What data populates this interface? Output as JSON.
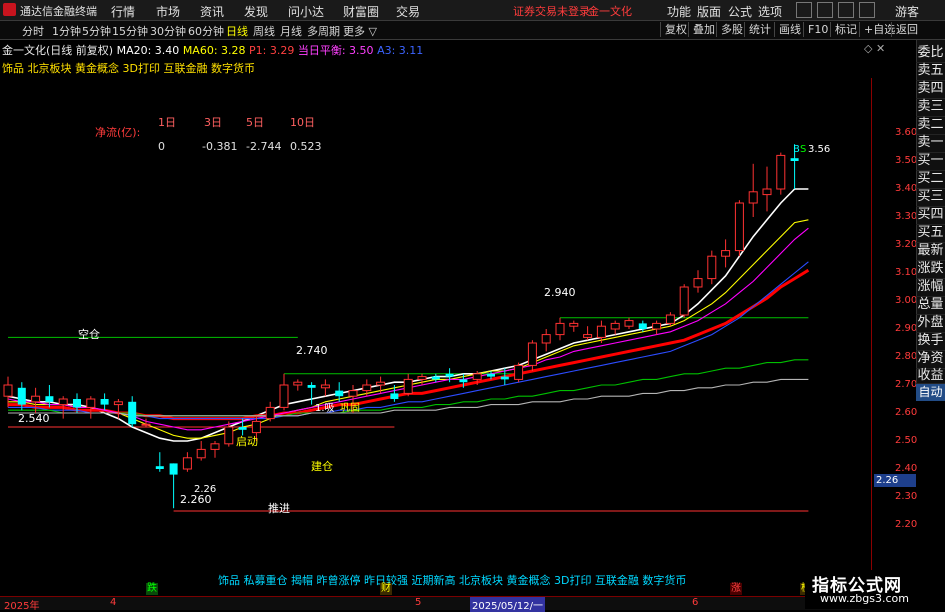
{
  "titlebar": {
    "app_title": "通达信金融终端",
    "menus": [
      "行情",
      "市场",
      "资讯",
      "发现",
      "问小达",
      "财富圈",
      "交易"
    ],
    "login_status": "证券交易未登录",
    "stock_name": "金一文化",
    "right_menus": [
      "功能",
      "版面",
      "公式",
      "选项"
    ],
    "guest": "游客"
  },
  "period_tabs": [
    "分时",
    "1分钟",
    "5分钟",
    "15分钟",
    "30分钟",
    "60分钟",
    "日线",
    "周线",
    "月线",
    "多周期",
    "更多 ▽"
  ],
  "active_period": "日线",
  "toolbar_buttons": [
    "复权",
    "叠加",
    "多股",
    "统计",
    "画线",
    "F10",
    "标记",
    "+自选",
    "返回"
  ],
  "info_line": {
    "stock": "金一文化(日线 前复权)",
    "ma20": "MA20: 3.40",
    "ma60": "MA60: 3.28",
    "p1": "P1: 3.29",
    "balance": "当日平衡: 3.50",
    "a3": "A3: 3.11"
  },
  "concept_line": "饰品 北京板块 黄金概念 3D打印 互联金融 数字货币",
  "net_flow": {
    "label": "净流(亿):",
    "headers": [
      "1日",
      "3日",
      "5日",
      "10日"
    ],
    "values": [
      "0",
      "-0.381",
      "-2.744",
      "0.523"
    ]
  },
  "sidebar_tabs": [
    "委比",
    "卖五",
    "卖四",
    "卖三",
    "卖二",
    "卖一",
    "买一",
    "买二",
    "买三",
    "买四",
    "买五",
    "最新",
    "涨跌",
    "涨幅",
    "总量",
    "外盘",
    "换手",
    "净资",
    "收益"
  ],
  "sidebar_auto": "自动",
  "price_ticks": [
    "3.60",
    "3.50",
    "3.40",
    "3.30",
    "3.20",
    "3.10",
    "3.00",
    "2.90",
    "2.80",
    "2.70",
    "2.60",
    "2.50",
    "2.40",
    "2.30",
    "2.20"
  ],
  "current_price_tag": "2.26",
  "annotations": {
    "kong_cang": "空仓",
    "qi_dong": "启动",
    "jian_cang": "建仓",
    "tui_jin": "推进",
    "low_a": "2.260",
    "low_b": "2.26",
    "left_low": "2.540",
    "high_a": "2.740",
    "high_b": "2.940",
    "recent_high": "3.56",
    "buy_mark": "B",
    "sell_mark": "S",
    "mid_label": "巩固",
    "mid_label2": "1.吸"
  },
  "bottom_concepts": "饰品 私募重仓 揭帽 昨曾涨停 昨日较强 近期新高 北京板块 黄金概念 3D打印 互联金融 数字货币",
  "event_marks": {
    "die": "跌",
    "cai": "财",
    "zhang": "涨",
    "bang": "榜"
  },
  "date_labels": [
    "2025年",
    "4",
    "5",
    "6"
  ],
  "date_cursor": "2025/05/12/一",
  "watermark": {
    "cn": "指标公式网",
    "url": "www.zbgs3.com"
  },
  "colors": {
    "up": "#ff3232",
    "down": "#00ffff",
    "accent": "#ffff00",
    "axis": "#ff3b3b"
  },
  "chart_data": {
    "type": "candlestick",
    "ylim": [
      2.14,
      3.68
    ],
    "candles": [
      {
        "o": 2.66,
        "h": 2.73,
        "l": 2.62,
        "c": 2.7
      },
      {
        "o": 2.69,
        "h": 2.71,
        "l": 2.61,
        "c": 2.63
      },
      {
        "o": 2.64,
        "h": 2.69,
        "l": 2.6,
        "c": 2.66
      },
      {
        "o": 2.66,
        "h": 2.7,
        "l": 2.62,
        "c": 2.64
      },
      {
        "o": 2.63,
        "h": 2.66,
        "l": 2.58,
        "c": 2.65
      },
      {
        "o": 2.65,
        "h": 2.67,
        "l": 2.6,
        "c": 2.62
      },
      {
        "o": 2.62,
        "h": 2.66,
        "l": 2.58,
        "c": 2.65
      },
      {
        "o": 2.65,
        "h": 2.67,
        "l": 2.61,
        "c": 2.63
      },
      {
        "o": 2.63,
        "h": 2.65,
        "l": 2.58,
        "c": 2.64
      },
      {
        "o": 2.64,
        "h": 2.66,
        "l": 2.55,
        "c": 2.56
      },
      {
        "o": 2.56,
        "h": 2.58,
        "l": 2.55,
        "c": 2.56
      },
      {
        "o": 2.41,
        "h": 2.46,
        "l": 2.39,
        "c": 2.4
      },
      {
        "o": 2.42,
        "h": 2.42,
        "l": 2.26,
        "c": 2.38
      },
      {
        "o": 2.4,
        "h": 2.46,
        "l": 2.39,
        "c": 2.44
      },
      {
        "o": 2.44,
        "h": 2.5,
        "l": 2.43,
        "c": 2.47
      },
      {
        "o": 2.47,
        "h": 2.5,
        "l": 2.44,
        "c": 2.49
      },
      {
        "o": 2.49,
        "h": 2.57,
        "l": 2.48,
        "c": 2.55
      },
      {
        "o": 2.55,
        "h": 2.58,
        "l": 2.52,
        "c": 2.54
      },
      {
        "o": 2.53,
        "h": 2.59,
        "l": 2.5,
        "c": 2.57
      },
      {
        "o": 2.58,
        "h": 2.64,
        "l": 2.57,
        "c": 2.62
      },
      {
        "o": 2.62,
        "h": 2.74,
        "l": 2.61,
        "c": 2.7
      },
      {
        "o": 2.7,
        "h": 2.72,
        "l": 2.68,
        "c": 2.71
      },
      {
        "o": 2.7,
        "h": 2.71,
        "l": 2.63,
        "c": 2.69
      },
      {
        "o": 2.69,
        "h": 2.72,
        "l": 2.66,
        "c": 2.7
      },
      {
        "o": 2.68,
        "h": 2.71,
        "l": 2.64,
        "c": 2.66
      },
      {
        "o": 2.66,
        "h": 2.7,
        "l": 2.6,
        "c": 2.68
      },
      {
        "o": 2.68,
        "h": 2.72,
        "l": 2.66,
        "c": 2.7
      },
      {
        "o": 2.7,
        "h": 2.73,
        "l": 2.67,
        "c": 2.71
      },
      {
        "o": 2.67,
        "h": 2.7,
        "l": 2.64,
        "c": 2.65
      },
      {
        "o": 2.67,
        "h": 2.74,
        "l": 2.66,
        "c": 2.72
      },
      {
        "o": 2.72,
        "h": 2.74,
        "l": 2.7,
        "c": 2.73
      },
      {
        "o": 2.73,
        "h": 2.74,
        "l": 2.71,
        "c": 2.72
      },
      {
        "o": 2.74,
        "h": 2.76,
        "l": 2.71,
        "c": 2.73
      },
      {
        "o": 2.72,
        "h": 2.74,
        "l": 2.69,
        "c": 2.71
      },
      {
        "o": 2.72,
        "h": 2.75,
        "l": 2.7,
        "c": 2.74
      },
      {
        "o": 2.74,
        "h": 2.75,
        "l": 2.72,
        "c": 2.73
      },
      {
        "o": 2.73,
        "h": 2.76,
        "l": 2.7,
        "c": 2.72
      },
      {
        "o": 2.72,
        "h": 2.78,
        "l": 2.71,
        "c": 2.77
      },
      {
        "o": 2.77,
        "h": 2.86,
        "l": 2.75,
        "c": 2.85
      },
      {
        "o": 2.85,
        "h": 2.9,
        "l": 2.82,
        "c": 2.88
      },
      {
        "o": 2.88,
        "h": 2.94,
        "l": 2.86,
        "c": 2.92
      },
      {
        "o": 2.91,
        "h": 2.93,
        "l": 2.89,
        "c": 2.92
      },
      {
        "o": 2.87,
        "h": 2.91,
        "l": 2.86,
        "c": 2.88
      },
      {
        "o": 2.87,
        "h": 2.93,
        "l": 2.85,
        "c": 2.91
      },
      {
        "o": 2.9,
        "h": 2.93,
        "l": 2.88,
        "c": 2.92
      },
      {
        "o": 2.91,
        "h": 2.94,
        "l": 2.9,
        "c": 2.93
      },
      {
        "o": 2.92,
        "h": 2.93,
        "l": 2.89,
        "c": 2.9
      },
      {
        "o": 2.9,
        "h": 2.93,
        "l": 2.88,
        "c": 2.92
      },
      {
        "o": 2.92,
        "h": 2.96,
        "l": 2.91,
        "c": 2.95
      },
      {
        "o": 2.95,
        "h": 3.06,
        "l": 2.94,
        "c": 3.05
      },
      {
        "o": 3.05,
        "h": 3.11,
        "l": 3.03,
        "c": 3.08
      },
      {
        "o": 3.08,
        "h": 3.18,
        "l": 3.06,
        "c": 3.16
      },
      {
        "o": 3.16,
        "h": 3.22,
        "l": 3.12,
        "c": 3.18
      },
      {
        "o": 3.18,
        "h": 3.36,
        "l": 3.16,
        "c": 3.35
      },
      {
        "o": 3.35,
        "h": 3.49,
        "l": 3.3,
        "c": 3.39
      },
      {
        "o": 3.38,
        "h": 3.48,
        "l": 3.32,
        "c": 3.4
      },
      {
        "o": 3.4,
        "h": 3.53,
        "l": 3.38,
        "c": 3.52
      },
      {
        "o": 3.51,
        "h": 3.56,
        "l": 3.4,
        "c": 3.5
      }
    ],
    "ma_lines": [
      {
        "color": "#ffffff",
        "values": [
          2.66,
          2.65,
          2.64,
          2.64,
          2.63,
          2.63,
          2.62,
          2.6,
          2.58,
          2.55,
          2.53,
          2.51,
          2.5,
          2.5,
          2.51,
          2.53,
          2.55,
          2.57,
          2.59,
          2.61,
          2.63,
          2.64,
          2.65,
          2.66,
          2.67,
          2.68,
          2.69,
          2.7,
          2.71,
          2.71,
          2.72,
          2.73,
          2.73,
          2.74,
          2.74,
          2.75,
          2.76,
          2.77,
          2.79,
          2.81,
          2.83,
          2.85,
          2.86,
          2.87,
          2.88,
          2.89,
          2.9,
          2.91,
          2.92,
          2.95,
          2.99,
          3.04,
          3.09,
          3.16,
          3.23,
          3.29,
          3.35,
          3.4,
          3.4
        ]
      },
      {
        "color": "#ffff00",
        "values": [
          2.64,
          2.64,
          2.63,
          2.63,
          2.63,
          2.62,
          2.62,
          2.61,
          2.6,
          2.58,
          2.56,
          2.54,
          2.52,
          2.51,
          2.51,
          2.52,
          2.53,
          2.55,
          2.56,
          2.58,
          2.6,
          2.61,
          2.62,
          2.64,
          2.65,
          2.66,
          2.67,
          2.68,
          2.69,
          2.7,
          2.71,
          2.72,
          2.72,
          2.73,
          2.74,
          2.75,
          2.75,
          2.76,
          2.78,
          2.8,
          2.82,
          2.84,
          2.85,
          2.86,
          2.87,
          2.88,
          2.89,
          2.9,
          2.91,
          2.93,
          2.96,
          2.99,
          3.03,
          3.08,
          3.13,
          3.18,
          3.23,
          3.28,
          3.29
        ]
      },
      {
        "color": "#ff0000",
        "values": [
          2.63,
          2.63,
          2.62,
          2.62,
          2.62,
          2.61,
          2.61,
          2.61,
          2.6,
          2.6,
          2.59,
          2.59,
          2.58,
          2.58,
          2.58,
          2.58,
          2.58,
          2.58,
          2.59,
          2.59,
          2.6,
          2.6,
          2.61,
          2.62,
          2.63,
          2.63,
          2.64,
          2.65,
          2.66,
          2.67,
          2.67,
          2.68,
          2.69,
          2.7,
          2.71,
          2.72,
          2.73,
          2.74,
          2.75,
          2.76,
          2.77,
          2.78,
          2.79,
          2.8,
          2.81,
          2.82,
          2.83,
          2.84,
          2.85,
          2.86,
          2.88,
          2.9,
          2.92,
          2.95,
          2.98,
          3.01,
          3.05,
          3.08,
          3.11
        ]
      },
      {
        "color": "#ff00ff",
        "values": [
          2.65,
          2.64,
          2.64,
          2.63,
          2.63,
          2.62,
          2.62,
          2.61,
          2.6,
          2.59,
          2.57,
          2.56,
          2.55,
          2.54,
          2.54,
          2.55,
          2.56,
          2.57,
          2.58,
          2.59,
          2.6,
          2.61,
          2.62,
          2.63,
          2.64,
          2.65,
          2.66,
          2.67,
          2.68,
          2.69,
          2.7,
          2.71,
          2.72,
          2.72,
          2.73,
          2.74,
          2.75,
          2.76,
          2.77,
          2.79,
          2.8,
          2.82,
          2.83,
          2.84,
          2.85,
          2.86,
          2.87,
          2.88,
          2.89,
          2.91,
          2.93,
          2.96,
          2.99,
          3.03,
          3.07,
          3.12,
          3.17,
          3.22,
          3.26
        ]
      },
      {
        "color": "#2c4cff",
        "values": [
          2.62,
          2.62,
          2.62,
          2.61,
          2.61,
          2.61,
          2.6,
          2.6,
          2.6,
          2.59,
          2.59,
          2.58,
          2.58,
          2.58,
          2.58,
          2.58,
          2.58,
          2.58,
          2.58,
          2.58,
          2.59,
          2.59,
          2.6,
          2.6,
          2.61,
          2.61,
          2.62,
          2.62,
          2.63,
          2.64,
          2.64,
          2.65,
          2.66,
          2.67,
          2.68,
          2.69,
          2.7,
          2.71,
          2.72,
          2.73,
          2.74,
          2.75,
          2.76,
          2.77,
          2.78,
          2.79,
          2.8,
          2.81,
          2.82,
          2.84,
          2.86,
          2.88,
          2.91,
          2.94,
          2.98,
          3.02,
          3.06,
          3.1,
          3.14
        ]
      },
      {
        "color": "#00c000",
        "values": [
          2.61,
          2.61,
          2.61,
          2.61,
          2.6,
          2.6,
          2.6,
          2.6,
          2.6,
          2.6,
          2.59,
          2.59,
          2.59,
          2.59,
          2.59,
          2.59,
          2.59,
          2.59,
          2.59,
          2.59,
          2.59,
          2.6,
          2.6,
          2.6,
          2.6,
          2.61,
          2.61,
          2.61,
          2.62,
          2.62,
          2.62,
          2.63,
          2.63,
          2.64,
          2.64,
          2.65,
          2.65,
          2.66,
          2.66,
          2.67,
          2.68,
          2.68,
          2.69,
          2.7,
          2.7,
          2.71,
          2.72,
          2.72,
          2.73,
          2.74,
          2.74,
          2.75,
          2.76,
          2.76,
          2.77,
          2.78,
          2.78,
          2.79,
          2.79
        ]
      },
      {
        "color": "#b4b4b4",
        "values": [
          2.6,
          2.6,
          2.6,
          2.6,
          2.6,
          2.6,
          2.6,
          2.6,
          2.6,
          2.59,
          2.59,
          2.59,
          2.59,
          2.59,
          2.59,
          2.59,
          2.59,
          2.59,
          2.59,
          2.59,
          2.59,
          2.59,
          2.6,
          2.6,
          2.6,
          2.6,
          2.6,
          2.6,
          2.61,
          2.61,
          2.61,
          2.61,
          2.62,
          2.62,
          2.62,
          2.63,
          2.63,
          2.63,
          2.64,
          2.64,
          2.64,
          2.65,
          2.65,
          2.66,
          2.66,
          2.66,
          2.67,
          2.67,
          2.68,
          2.68,
          2.69,
          2.69,
          2.7,
          2.7,
          2.71,
          2.71,
          2.72,
          2.72,
          2.72
        ]
      }
    ],
    "hlines": [
      {
        "y": 2.87,
        "x0": 0,
        "x1": 21,
        "color": "#00c000"
      },
      {
        "y": 2.55,
        "x0": 0,
        "x1": 28,
        "color": "#ff3232"
      },
      {
        "y": 2.25,
        "x0": 12,
        "x1": 58,
        "color": "#ff3232"
      },
      {
        "y": 2.94,
        "x0": 40,
        "x1": 58,
        "color": "#00c000"
      },
      {
        "y": 2.74,
        "x0": 20,
        "x1": 37,
        "color": "#00c000"
      }
    ]
  }
}
